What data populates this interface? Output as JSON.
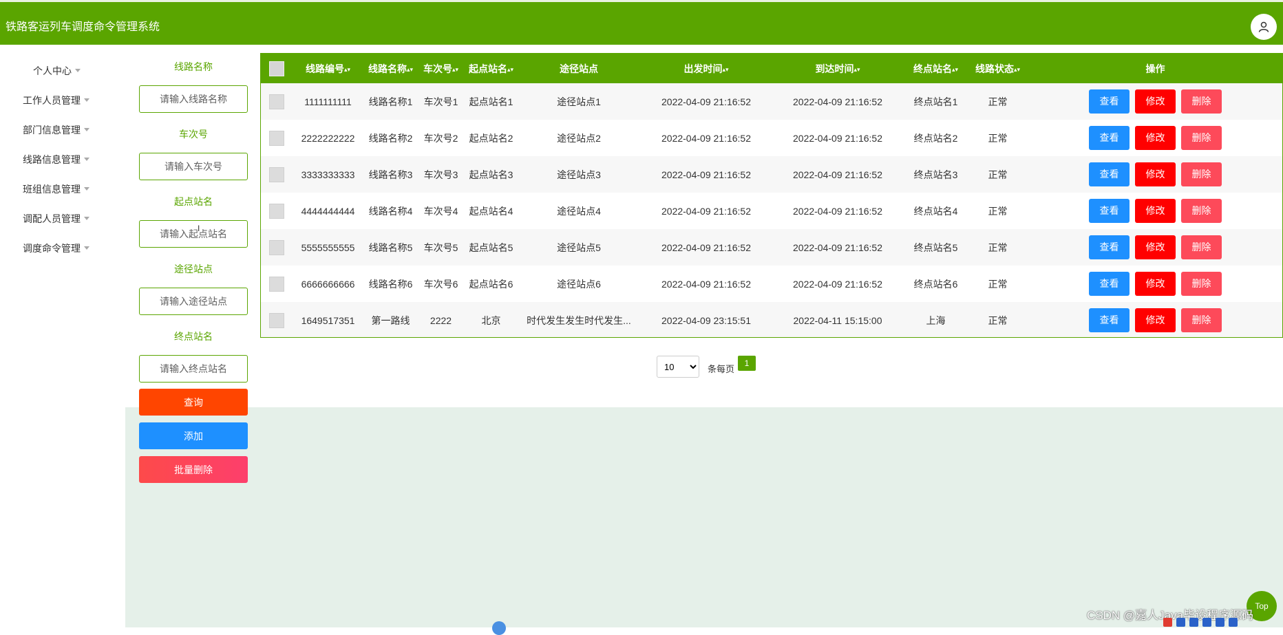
{
  "header": {
    "title": "铁路客运列车调度命令管理系统",
    "user_icon": "user-icon"
  },
  "sidebar": {
    "items": [
      {
        "label": "个人中心"
      },
      {
        "label": "工作人员管理"
      },
      {
        "label": "部门信息管理"
      },
      {
        "label": "线路信息管理"
      },
      {
        "label": "班组信息管理"
      },
      {
        "label": "调配人员管理"
      },
      {
        "label": "调度命令管理"
      }
    ]
  },
  "search": {
    "fields": [
      {
        "label": "线路名称",
        "placeholder": "请输入线路名称",
        "value": ""
      },
      {
        "label": "车次号",
        "placeholder": "请输入车次号",
        "value": ""
      },
      {
        "label": "起点站名",
        "placeholder": "请输入起点站名",
        "value": ""
      },
      {
        "label": "途径站点",
        "placeholder": "请输入途径站点",
        "value": ""
      },
      {
        "label": "终点站名",
        "placeholder": "请输入终点站名",
        "value": ""
      }
    ],
    "query_label": "查询",
    "add_label": "添加",
    "batch_delete_label": "批量删除"
  },
  "table": {
    "columns": [
      "线路编号",
      "线路名称",
      "车次号",
      "起点站名",
      "途径站点",
      "出发时间",
      "到达时间",
      "终点站名",
      "线路状态",
      "操作"
    ],
    "sortable": [
      true,
      true,
      true,
      true,
      false,
      true,
      true,
      true,
      true,
      false
    ],
    "rows": [
      {
        "id": "1111111111",
        "name": "线路名称1",
        "train": "车次号1",
        "start": "起点站名1",
        "via": "途径站点1",
        "depart": "2022-04-09 21:16:52",
        "arrive": "2022-04-09 21:16:52",
        "end": "终点站名1",
        "status": "正常"
      },
      {
        "id": "2222222222",
        "name": "线路名称2",
        "train": "车次号2",
        "start": "起点站名2",
        "via": "途径站点2",
        "depart": "2022-04-09 21:16:52",
        "arrive": "2022-04-09 21:16:52",
        "end": "终点站名2",
        "status": "正常"
      },
      {
        "id": "3333333333",
        "name": "线路名称3",
        "train": "车次号3",
        "start": "起点站名3",
        "via": "途径站点3",
        "depart": "2022-04-09 21:16:52",
        "arrive": "2022-04-09 21:16:52",
        "end": "终点站名3",
        "status": "正常"
      },
      {
        "id": "4444444444",
        "name": "线路名称4",
        "train": "车次号4",
        "start": "起点站名4",
        "via": "途径站点4",
        "depart": "2022-04-09 21:16:52",
        "arrive": "2022-04-09 21:16:52",
        "end": "终点站名4",
        "status": "正常"
      },
      {
        "id": "5555555555",
        "name": "线路名称5",
        "train": "车次号5",
        "start": "起点站名5",
        "via": "途径站点5",
        "depart": "2022-04-09 21:16:52",
        "arrive": "2022-04-09 21:16:52",
        "end": "终点站名5",
        "status": "正常"
      },
      {
        "id": "6666666666",
        "name": "线路名称6",
        "train": "车次号6",
        "start": "起点站名6",
        "via": "途径站点6",
        "depart": "2022-04-09 21:16:52",
        "arrive": "2022-04-09 21:16:52",
        "end": "终点站名6",
        "status": "正常"
      },
      {
        "id": "1649517351",
        "name": "第一路线",
        "train": "2222",
        "start": "北京",
        "via": "时代发生发生时代发生...",
        "depart": "2022-04-09 23:15:51",
        "arrive": "2022-04-11 15:15:00",
        "end": "上海",
        "status": "正常"
      }
    ],
    "actions": {
      "view": "查看",
      "edit": "修改",
      "delete": "删除"
    }
  },
  "pagination": {
    "page_size_options": [
      "10"
    ],
    "page_size": "10",
    "per_page_label": "条每页",
    "current_page": "1"
  },
  "misc": {
    "top_label": "Top",
    "watermark": "CSDN @嘉人Java毕设程序源码"
  },
  "colors": {
    "primary": "#5aa500",
    "view": "#1e90ff",
    "edit": "#ff0000",
    "delete": "#fd4a5a",
    "query": "#ff4500",
    "add": "#1e90ff",
    "batch_delete": "#fd3f5c"
  }
}
